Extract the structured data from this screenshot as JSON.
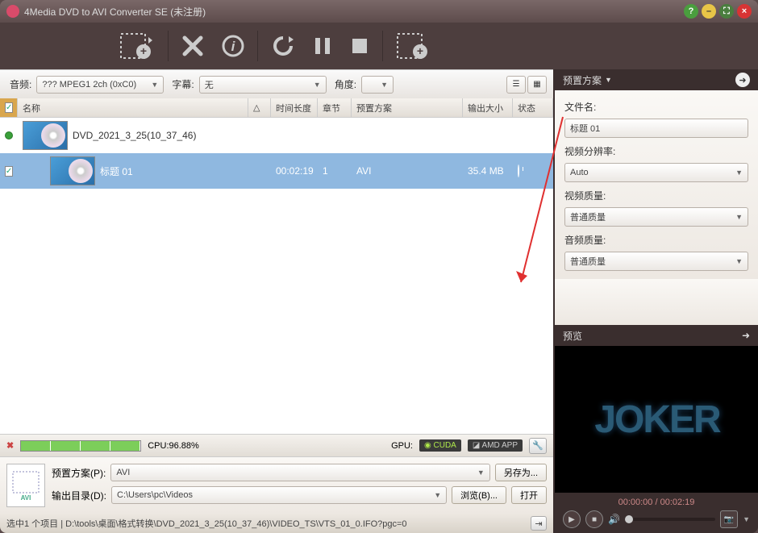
{
  "title": "4Media DVD to AVI Converter SE (未注册)",
  "filter": {
    "audio_label": "音频:",
    "audio_value": "??? MPEG1 2ch (0xC0)",
    "subtitle_label": "字幕:",
    "subtitle_value": "无",
    "angle_label": "角度:",
    "angle_value": ""
  },
  "columns": {
    "name": "名称",
    "duration": "时间长度",
    "chapter": "章节",
    "profile": "预置方案",
    "size": "输出大小",
    "status": "状态"
  },
  "rows": [
    {
      "checked": false,
      "name": "DVD_2021_3_25(10_37_46)",
      "duration": "",
      "chapter": "",
      "profile": "",
      "size": "",
      "status": ""
    },
    {
      "checked": true,
      "name": "标题 01",
      "duration": "00:02:19",
      "chapter": "1",
      "profile": "AVI",
      "size": "35.4 MB",
      "status": "clock"
    }
  ],
  "progress": {
    "cpu_label": "CPU:96.88%",
    "gpu_label": "GPU:",
    "cuda": "CUDA",
    "amd": "AMD APP"
  },
  "output": {
    "profile_label": "预置方案(P):",
    "profile_value": "AVI",
    "saveas_btn": "另存为...",
    "dir_label": "输出目录(D):",
    "dir_value": "C:\\Users\\pc\\Videos",
    "browse_btn": "浏览(B)...",
    "open_btn": "打开"
  },
  "statusbar": "选中1 个项目 | D:\\tools\\桌面\\格式转换\\DVD_2021_3_25(10_37_46)\\VIDEO_TS\\VTS_01_0.IFO?pgc=0",
  "settings": {
    "header": "预置方案",
    "filename_label": "文件名:",
    "filename_value": "标题 01",
    "res_label": "视频分辨率:",
    "res_value": "Auto",
    "vq_label": "视频质量:",
    "vq_value": "普通质量",
    "aq_label": "音频质量:",
    "aq_value": "普通质量"
  },
  "preview": {
    "header": "预览",
    "poster_text": "JOKER",
    "time": "00:00:00 / 00:02:19"
  }
}
